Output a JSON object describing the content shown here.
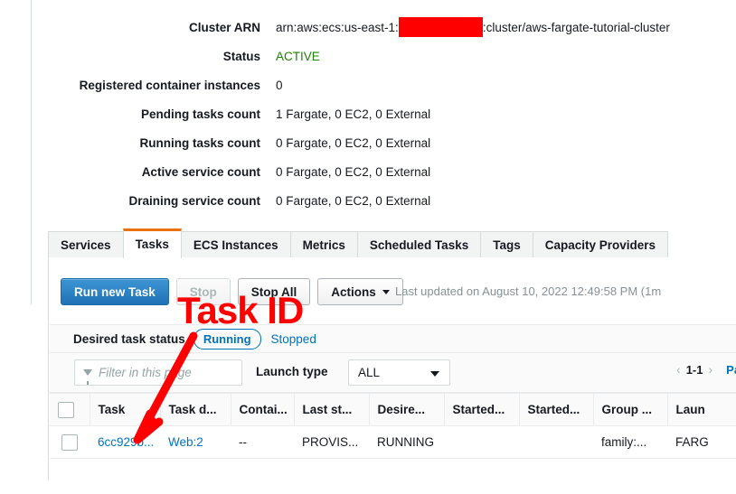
{
  "details": [
    {
      "label": "Cluster ARN",
      "value_prefix": "arn:aws:ecs:us-east-1:",
      "redacted": true,
      "value_suffix": ":cluster/aws-fargate-tutorial-cluster"
    },
    {
      "label": "Status",
      "value": "ACTIVE",
      "state": "active"
    },
    {
      "label": "Registered container instances",
      "value": "0"
    },
    {
      "label": "Pending tasks count",
      "value": "1 Fargate, 0 EC2, 0 External"
    },
    {
      "label": "Running tasks count",
      "value": "0 Fargate, 0 EC2, 0 External"
    },
    {
      "label": "Active service count",
      "value": "0 Fargate, 0 EC2, 0 External"
    },
    {
      "label": "Draining service count",
      "value": "0 Fargate, 0 EC2, 0 External"
    }
  ],
  "tabs": [
    {
      "label": "Services",
      "active": false
    },
    {
      "label": "Tasks",
      "active": true
    },
    {
      "label": "ECS Instances",
      "active": false
    },
    {
      "label": "Metrics",
      "active": false
    },
    {
      "label": "Scheduled Tasks",
      "active": false
    },
    {
      "label": "Tags",
      "active": false
    },
    {
      "label": "Capacity Providers",
      "active": false
    }
  ],
  "toolbar": {
    "run_new_task": "Run new Task",
    "stop": "Stop",
    "stop_all": "Stop All",
    "actions": "Actions",
    "last_updated": "Last updated on August 10, 2022 12:49:58 PM (1m"
  },
  "status_filter": {
    "label": "Desired task status",
    "running": "Running",
    "stopped": "Stopped"
  },
  "filter_bar": {
    "filter_placeholder": "Filter in this page",
    "launch_type_label": "Launch type",
    "launch_type_value": "ALL",
    "page_range": "1-1",
    "prev": "‹",
    "next": "›",
    "page_label": "Pag"
  },
  "table": {
    "columns": [
      "Task",
      "Task d...",
      "Contai...",
      "Last st...",
      "Desire...",
      "Started...",
      "Started...",
      "Group ...",
      "Laun"
    ],
    "rows": [
      {
        "task": "6cc929b...",
        "task_definition": "Web:2",
        "container_instance": "--",
        "last_status": "PROVIS...",
        "desired_status": "RUNNING",
        "started_by": "",
        "started_at": "",
        "group": "family:...",
        "launch_type": "FARG"
      }
    ]
  },
  "annotation": {
    "text": "Task ID",
    "color": "#fe0000"
  },
  "colors": {
    "accent_orange": "#ec7211",
    "link_blue": "#0073bb",
    "primary_button": "#1f72b5",
    "status_green": "#1d8102",
    "annotation_red": "#fe0000"
  }
}
